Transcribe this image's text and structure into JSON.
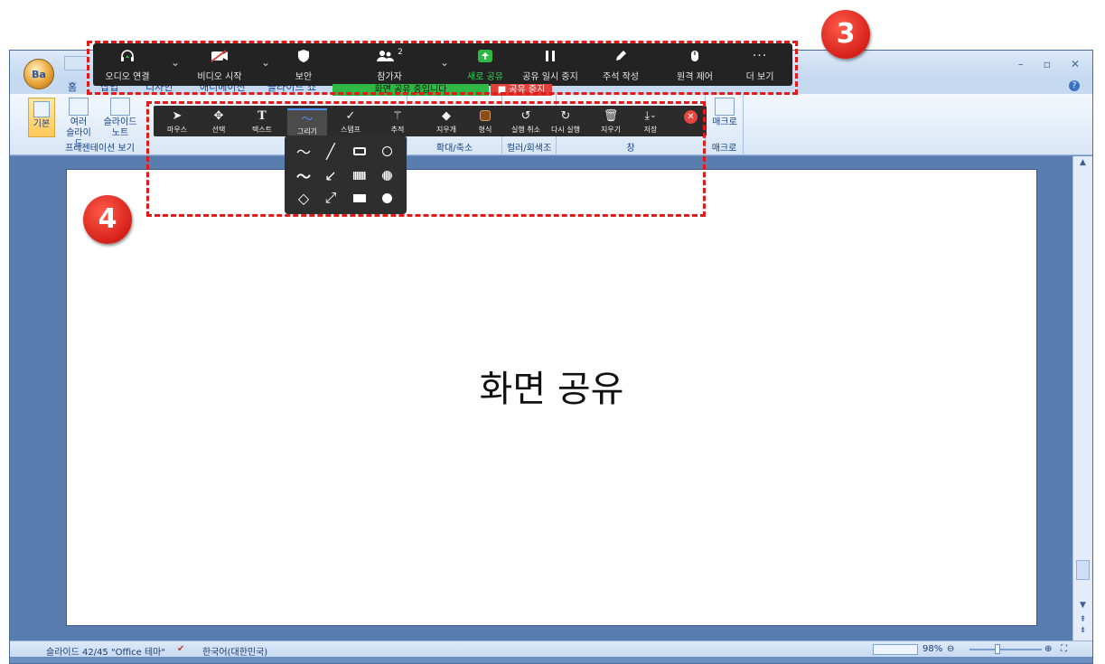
{
  "powerpoint": {
    "office_button": "Ba",
    "ribbon_tabs": [
      "홈",
      "삽입",
      "디자인",
      "애니메이션",
      "슬라이드 쇼"
    ],
    "ribbon": {
      "normal_label": "기본",
      "sorter_label_1": "여러",
      "sorter_label_2": "슬라이드",
      "notes_label_1": "슬라이드",
      "notes_label_2": "노트",
      "group_presentation_views": "프레젠테이션 보기",
      "group_zoom": "확대/축소",
      "group_color": "컬러/회색조",
      "group_window": "창",
      "macro_label": "매크로",
      "macro_group": "매크로"
    },
    "slide_title": "화면 공유",
    "status": {
      "slide_pos": "슬라이드 42/45",
      "theme": "\"Office 테마\"",
      "language": "한국어(대한민국)",
      "zoom": "98%"
    }
  },
  "meeting_toolbar": {
    "audio": "오디오 연결",
    "video": "비디오 시작",
    "security": "보안",
    "participants": "참가자",
    "participants_count": "2",
    "new_share": "새로 공유",
    "pause_share": "공유 일시 중지",
    "annotate": "주석 작성",
    "remote_control": "원격 제어",
    "more": "더 보기",
    "sharing_banner": "화면 공유 중입니다",
    "stop_share": "■ 공유 중지"
  },
  "annotation_toolbar": {
    "tools": [
      "마우스",
      "선택",
      "텍스트",
      "그리기",
      "스탬프",
      "추적",
      "지우개",
      "형식",
      "실행 취소",
      "다시 실행",
      "지우기",
      "저장"
    ],
    "selected_tool": "그리기"
  },
  "callouts": {
    "badge_3": "3",
    "badge_4": "4"
  },
  "colors": {
    "accent_red": "#e11a1a",
    "share_green": "#2fb844",
    "toolbar_dark": "#232323"
  }
}
